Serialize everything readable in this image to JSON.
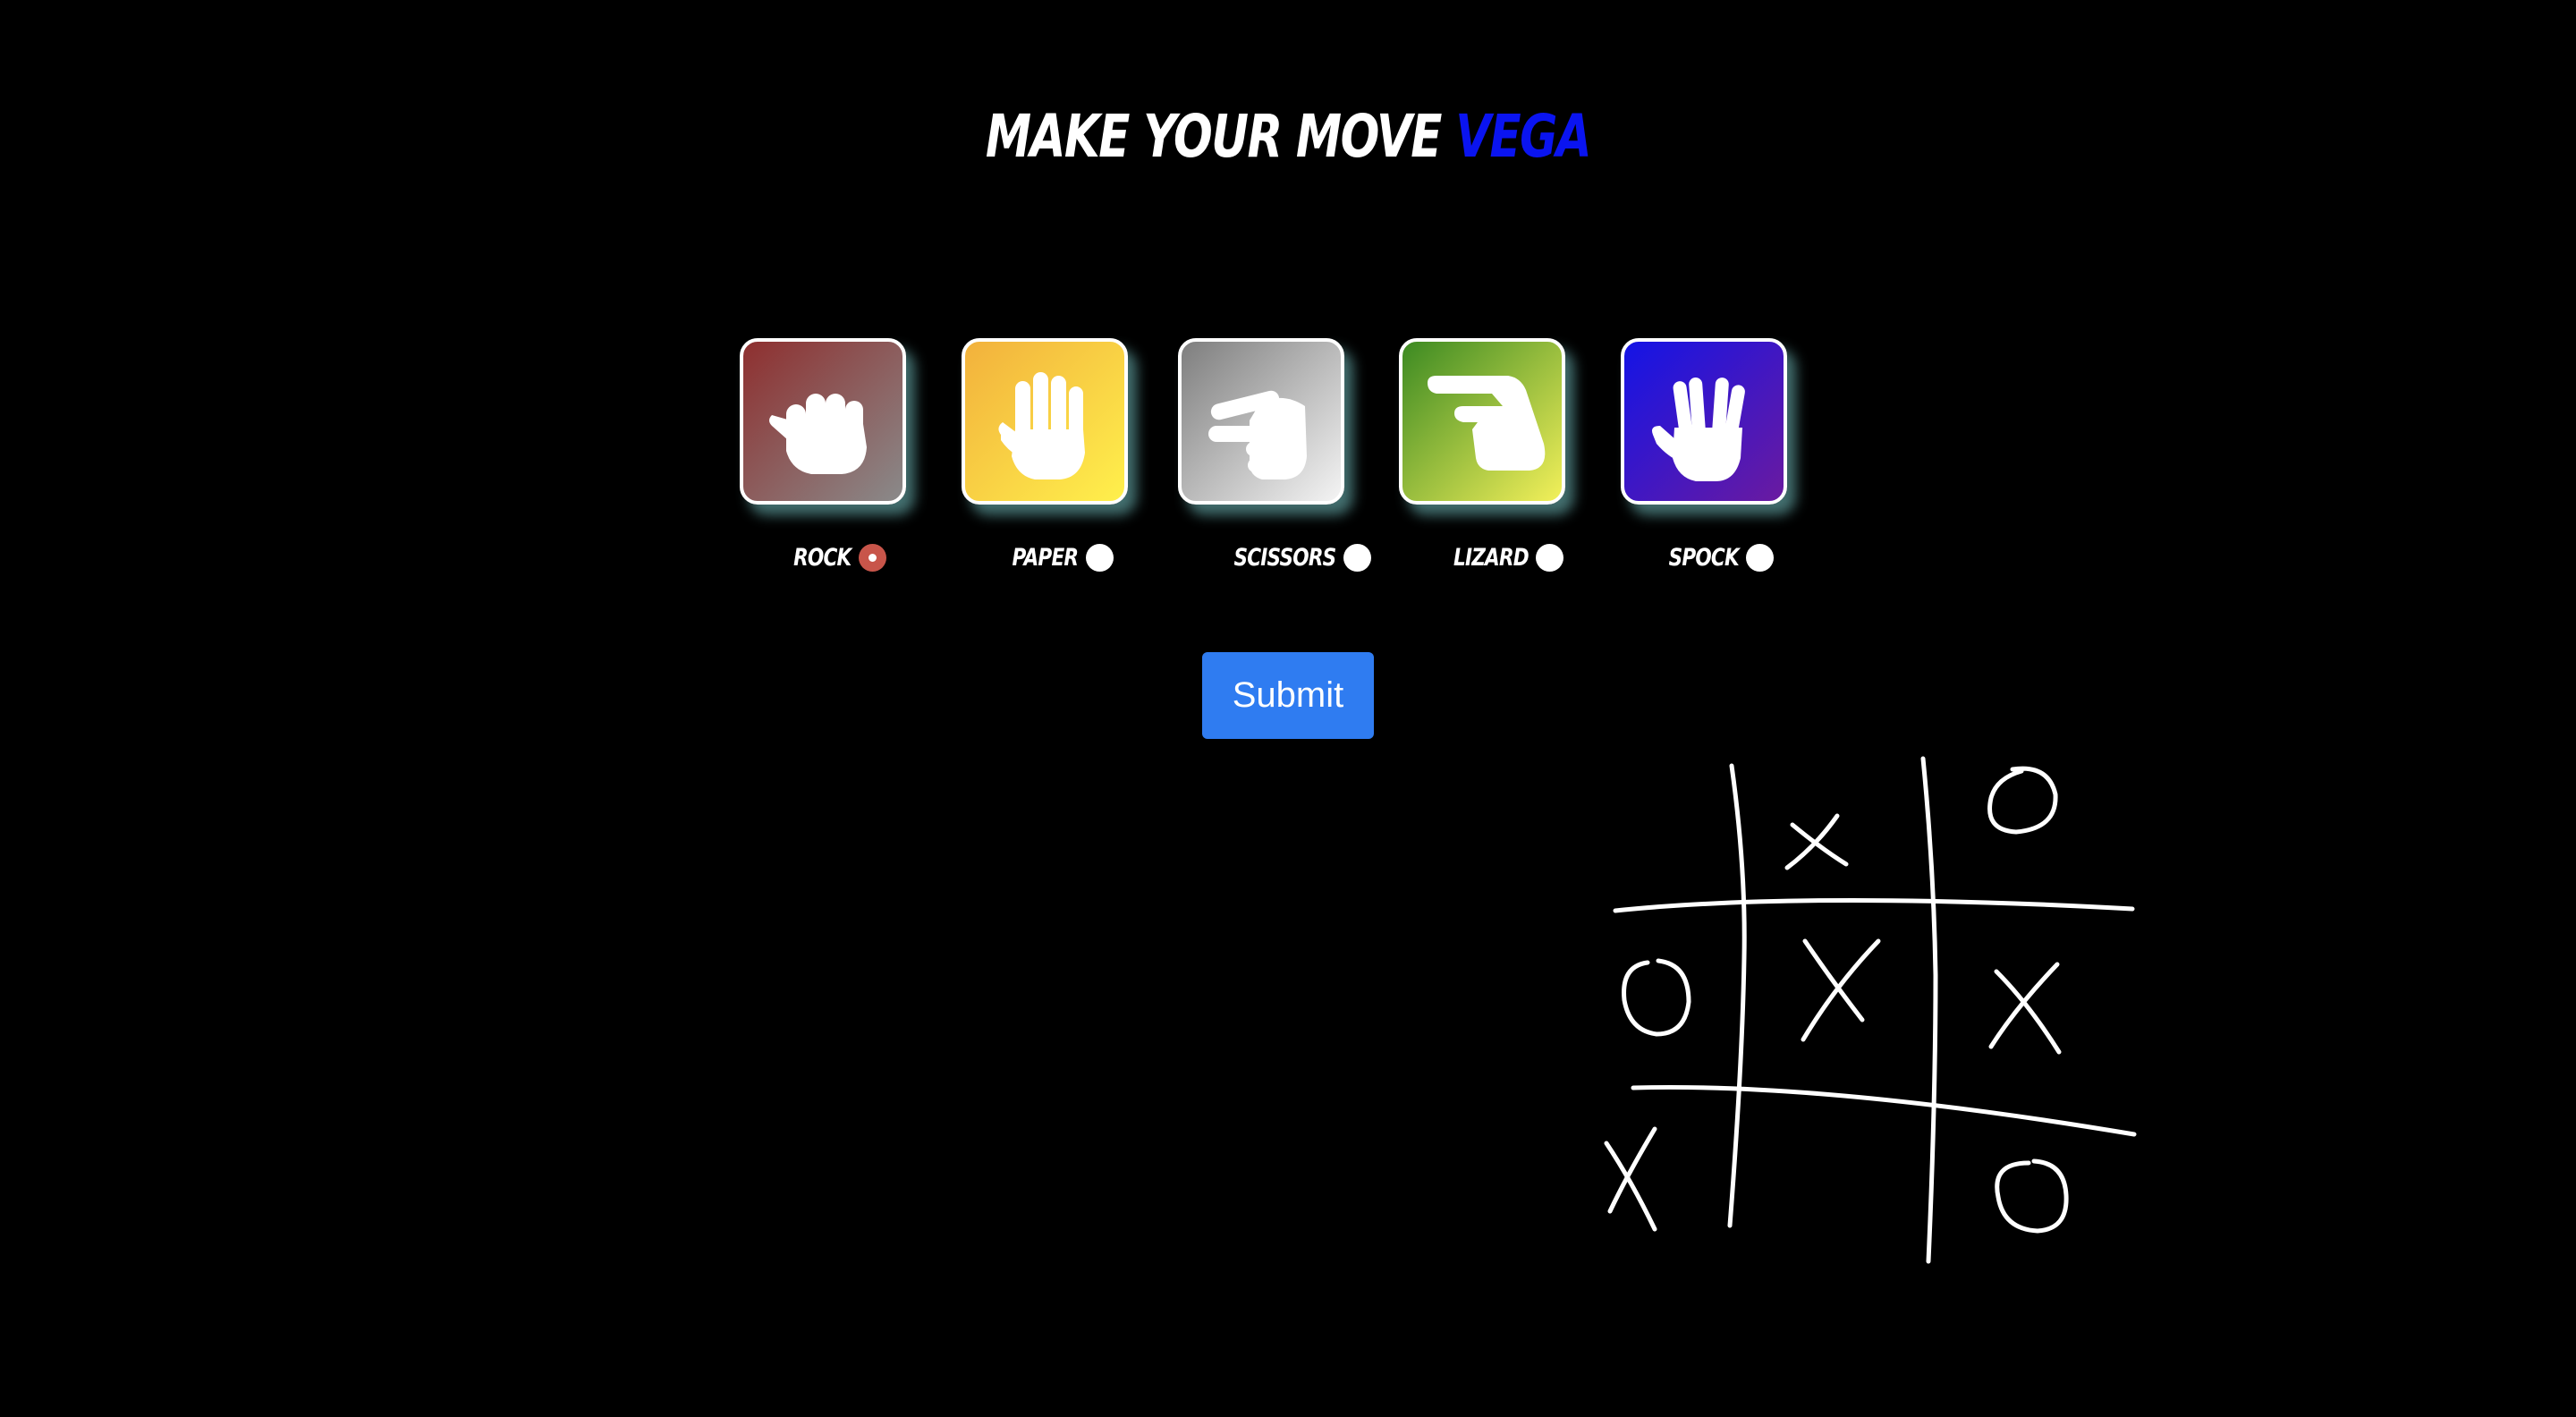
{
  "title": {
    "prefix": "Make your move",
    "name": "Vega",
    "name_color": "#0a14f0"
  },
  "choices": [
    {
      "label": "Rock",
      "icon": "fist-icon",
      "gradient": [
        "#8e2f2f",
        "#8a8a8a"
      ],
      "selected": true
    },
    {
      "label": "Paper",
      "icon": "open-hand-icon",
      "gradient": [
        "#f2b13c",
        "#fff04c"
      ],
      "selected": false
    },
    {
      "label": "Scissors",
      "icon": "scissors-hand-icon",
      "gradient": [
        "#7e7e7e",
        "#f4f4f4"
      ],
      "selected": false
    },
    {
      "label": "Lizard",
      "icon": "lizard-hand-icon",
      "gradient": [
        "#3c8a22",
        "#f3f05a"
      ],
      "selected": false
    },
    {
      "label": "Spock",
      "icon": "vulcan-salute-icon",
      "gradient": [
        "#1414e6",
        "#6a1aa0"
      ],
      "selected": false
    }
  ],
  "submit": {
    "label": "Submit",
    "color": "#2f7cf1"
  },
  "board_image": {
    "icon": "tic-tac-toe-chalk-icon",
    "cells": [
      "",
      "X",
      "O",
      "O",
      "X",
      "X",
      "X",
      "",
      "O"
    ]
  }
}
